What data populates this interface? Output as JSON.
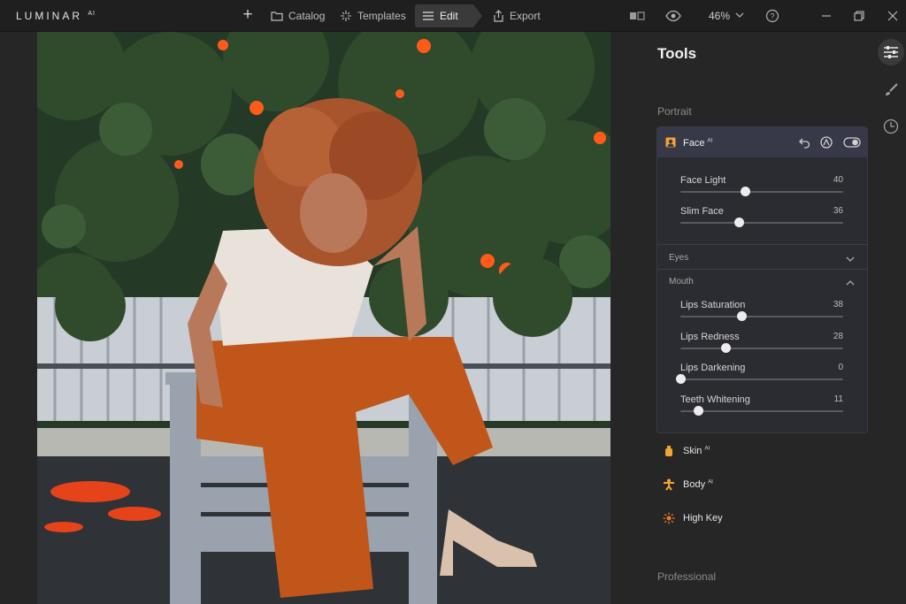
{
  "app": {
    "logo": "LUMINAR",
    "logo_sup": "AI",
    "nav": [
      {
        "label": "Catalog",
        "icon": "folder-icon"
      },
      {
        "label": "Templates",
        "icon": "sparkle-icon"
      },
      {
        "label": "Edit",
        "icon": "sliders-icon",
        "active": true
      },
      {
        "label": "Export",
        "icon": "export-icon"
      }
    ],
    "zoom": "46%"
  },
  "panel": {
    "title": "Tools",
    "portrait_label": "Portrait",
    "professional_label": "Professional",
    "face": {
      "name": "Face",
      "ai_badge": "AI",
      "sliders": [
        {
          "label": "Face Light",
          "value": 40
        },
        {
          "label": "Slim Face",
          "value": 36
        }
      ],
      "eyes_label": "Eyes",
      "mouth_label": "Mouth",
      "mouth_sliders": [
        {
          "label": "Lips Saturation",
          "value": 38
        },
        {
          "label": "Lips Redness",
          "value": 28
        },
        {
          "label": "Lips Darkening",
          "value": 0
        },
        {
          "label": "Teeth Whitening",
          "value": 11
        }
      ]
    },
    "tools": [
      {
        "label": "Skin",
        "ai": "AI",
        "color": "#f2a531"
      },
      {
        "label": "Body",
        "ai": "AI",
        "color": "#f2a531"
      },
      {
        "label": "High Key",
        "ai": "",
        "color": "#f07a2a"
      }
    ]
  },
  "colors": {
    "accent_orange": "#f2a531",
    "card_header": "#373949",
    "background": "#262626"
  }
}
